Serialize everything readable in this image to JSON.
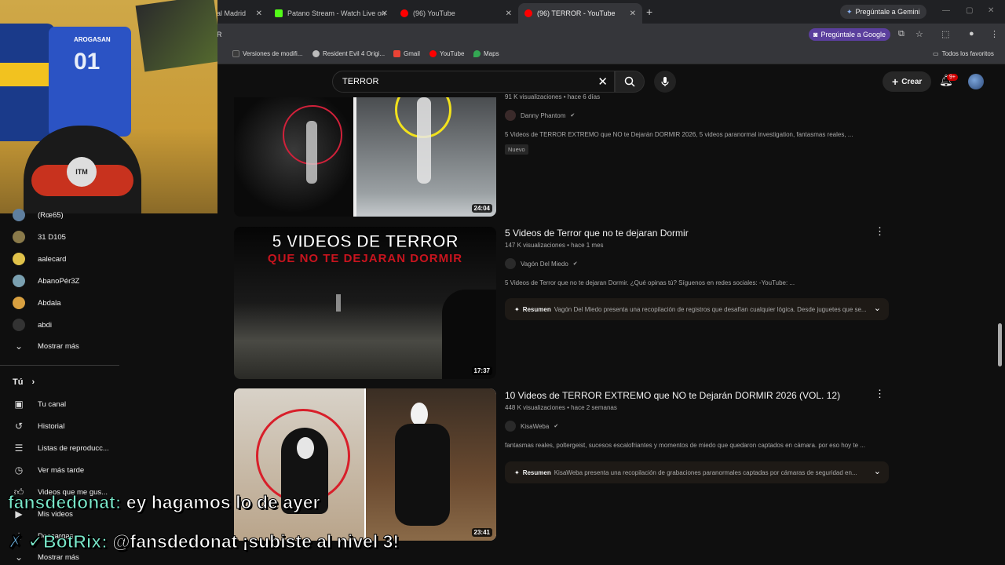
{
  "browser": {
    "tabs": [
      {
        "label": "al Madrid",
        "color": "#ffffff"
      },
      {
        "label": "Patano Stream - Watch Live on",
        "color": "#53fc18"
      },
      {
        "label": "(96) YouTube",
        "color": "#ff0000"
      },
      {
        "label": "(96) TERROR - YouTube",
        "color": "#ff0000"
      }
    ],
    "gemini_label": "Pregúntale a Gemini",
    "url_fragment": "R",
    "ask_google_label": "Pregúntale a Google",
    "bookmarks": [
      {
        "label": "Versiones de modifi...",
        "color": "#3b3b3b"
      },
      {
        "label": "Resident Evil 4 Origi...",
        "color": "#bbbbbb"
      },
      {
        "label": "Gmail",
        "color": "#ea4335"
      },
      {
        "label": "YouTube",
        "color": "#ff0000"
      },
      {
        "label": "Maps",
        "color": "#34a853"
      }
    ],
    "favorites_label": "Todos los favoritos"
  },
  "youtube": {
    "search_query": "TERROR",
    "create_label": "Crear",
    "notif_count": "9+"
  },
  "webcam": {
    "jersey_name": "AROGASAN",
    "jersey_number": "01",
    "chair_logo": "ITM"
  },
  "sidebar": {
    "subscriptions": [
      {
        "name": "(Rœ65)",
        "color": "#5f7f9f"
      },
      {
        "name": "31 D105",
        "color": "#8a7a4a"
      },
      {
        "name": "aalecard",
        "color": "#e0c24a"
      },
      {
        "name": "AbanoPér3Z",
        "color": "#7aa0b0"
      },
      {
        "name": "Abdala",
        "color": "#d8a040"
      },
      {
        "name": "abdi",
        "color": "#333333"
      }
    ],
    "show_more": "Mostrar más",
    "you_heading": "Tú",
    "you_items": [
      {
        "label": "Tu canal",
        "icon": "channel-icon"
      },
      {
        "label": "Historial",
        "icon": "history-icon"
      },
      {
        "label": "Listas de reproducc...",
        "icon": "playlist-icon"
      },
      {
        "label": "Ver más tarde",
        "icon": "watch-later-icon"
      },
      {
        "label": "Videos que me gus...",
        "icon": "like-icon"
      },
      {
        "label": "Mis videos",
        "icon": "my-videos-icon"
      },
      {
        "label": "Descargas",
        "icon": "download-icon"
      }
    ],
    "show_more_2": "Mostrar más"
  },
  "results": [
    {
      "meta": "91 K visualizaciones • hace 6 días",
      "channel": "Danny Phantom",
      "description": "5 Videos de TERROR EXTREMO que NO te Dejarán DORMIR 2026, 5 videos paranormal investigation, fantasmas reales, ...",
      "badge": "Nuevo",
      "duration": "24:04"
    },
    {
      "title": "5 Videos de Terror que no te dejaran Dormir",
      "meta": "147 K visualizaciones • hace 1 mes",
      "channel": "Vagón Del Miedo",
      "description": "5 Videos de Terror que no te dejaran Dormir. ¿Qué opinas tú? Síguenos en redes sociales: -YouTube: ...",
      "summary_label": "Resumen",
      "summary": "Vagón Del Miedo presenta una recopilación de registros que desafían cualquier lógica. Desde juguetes que se...",
      "duration": "17:37",
      "thumb_line1": "5 VIDEOS DE TERROR",
      "thumb_line2": "QUE NO TE DEJARAN DORMIR"
    },
    {
      "title": "10 Videos de TERROR EXTREMO que NO te Dejarán DORMIR 2026 (VOL. 12)",
      "meta": "448 K visualizaciones • hace 2 semanas",
      "channel": "KisaWeba",
      "description": "fantasmas reales, poltergeist, sucesos escalofriantes y momentos de miedo que quedaron captados en cámara. por eso hoy te ...",
      "summary_label": "Resumen",
      "summary": "KisaWeba presenta una recopilación de grabaciones paranormales captadas por cámaras de seguridad en...",
      "duration": "23:41"
    }
  ],
  "chat": {
    "msg1_user": "fansdedonat:",
    "msg1_text": "ey hagamos lo de ayer",
    "msg2_user": "BotRix:",
    "msg2_text": "@fansdedonat ¡subiste al nivel 3!"
  }
}
